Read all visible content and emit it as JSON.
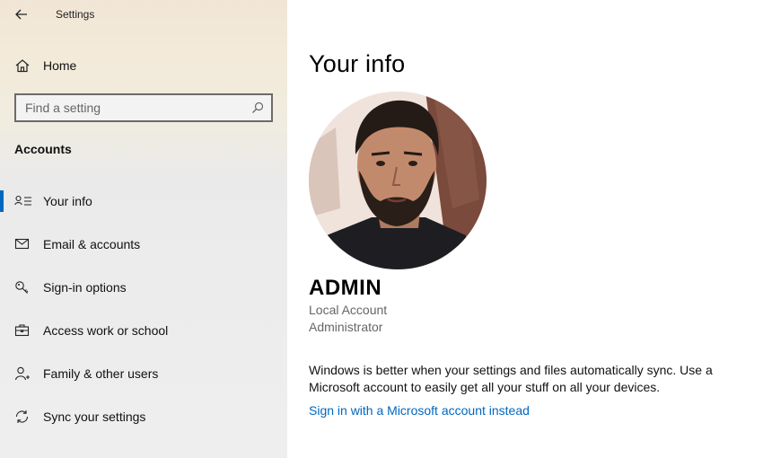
{
  "window": {
    "title": "Settings"
  },
  "sidebar": {
    "home_label": "Home",
    "search": {
      "placeholder": "Find a setting"
    },
    "section_title": "Accounts",
    "items": [
      {
        "label": "Your info",
        "icon": "person-list-icon",
        "active": true
      },
      {
        "label": "Email & accounts",
        "icon": "mail-icon",
        "active": false
      },
      {
        "label": "Sign-in options",
        "icon": "key-icon",
        "active": false
      },
      {
        "label": "Access work or school",
        "icon": "briefcase-icon",
        "active": false
      },
      {
        "label": "Family & other users",
        "icon": "person-add-icon",
        "active": false
      },
      {
        "label": "Sync your settings",
        "icon": "sync-icon",
        "active": false
      }
    ]
  },
  "main": {
    "title": "Your info",
    "user": {
      "name": "ADMIN",
      "account_type": "Local Account",
      "role": "Administrator"
    },
    "sync_message": "Windows is better when your settings and files automatically sync. Use a Microsoft account to easily get all your stuff on all your devices.",
    "link_label": "Sign in with a Microsoft account instead"
  },
  "colors": {
    "accent": "#0067c0",
    "link": "#0067c0",
    "secondary_text": "#666666"
  }
}
